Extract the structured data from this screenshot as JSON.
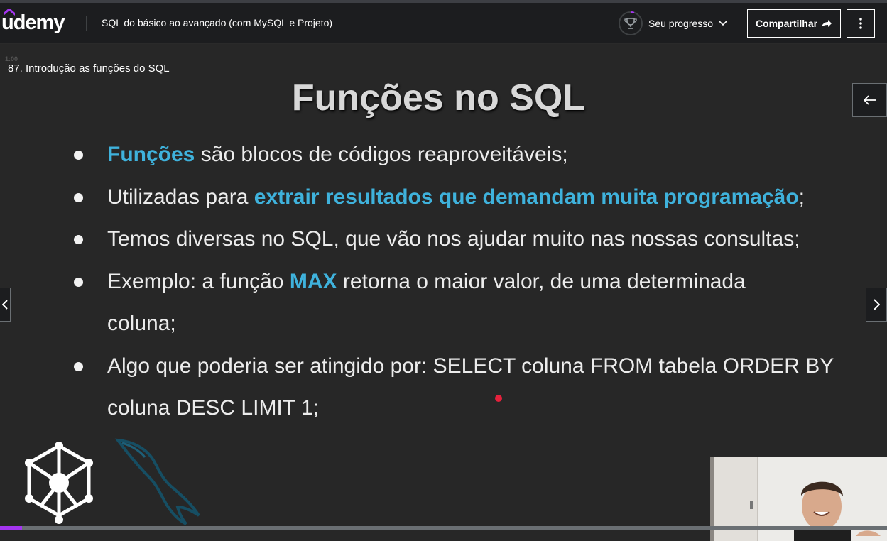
{
  "header": {
    "logo_text": "udemy",
    "course_title": "SQL do básico ao avançado (com MySQL e Projeto)",
    "progress_label": "Seu progresso",
    "share_label": "Compartilhar"
  },
  "video": {
    "lecture_time": "1:00",
    "lecture_title": "87. Introdução as funções do SQL",
    "progress_fraction": 0.025
  },
  "slide": {
    "title": "Funções no SQL",
    "bullets": [
      {
        "hl": "Funções",
        "after": " são blocos de códigos reaproveitáveis;"
      },
      {
        "before": "Utilizadas para ",
        "hl": "extrair resultados que demandam muita programação",
        "after": ";"
      },
      {
        "text": "Temos diversas no SQL, que vão nos ajudar muito nas nossas consultas;"
      },
      {
        "before": "Exemplo: a função ",
        "hl": "MAX",
        "after": " retorna o maior valor, de uma determinada coluna;"
      },
      {
        "text": "Algo que poderia ser atingido por: SELECT coluna FROM tabela ORDER BY coluna DESC LIMIT 1;"
      }
    ]
  },
  "colors": {
    "accent": "#a435f0",
    "highlight": "#3fb2dc",
    "header_bg": "#1c1d1f"
  },
  "icons": [
    "udemy-logo",
    "trophy-icon",
    "chevron-down-icon",
    "share-arrow-icon",
    "kebab-menu-icon",
    "arrow-left-icon",
    "chevron-left-icon",
    "chevron-right-icon",
    "network-cube-logo",
    "mysql-dolphin-logo"
  ]
}
